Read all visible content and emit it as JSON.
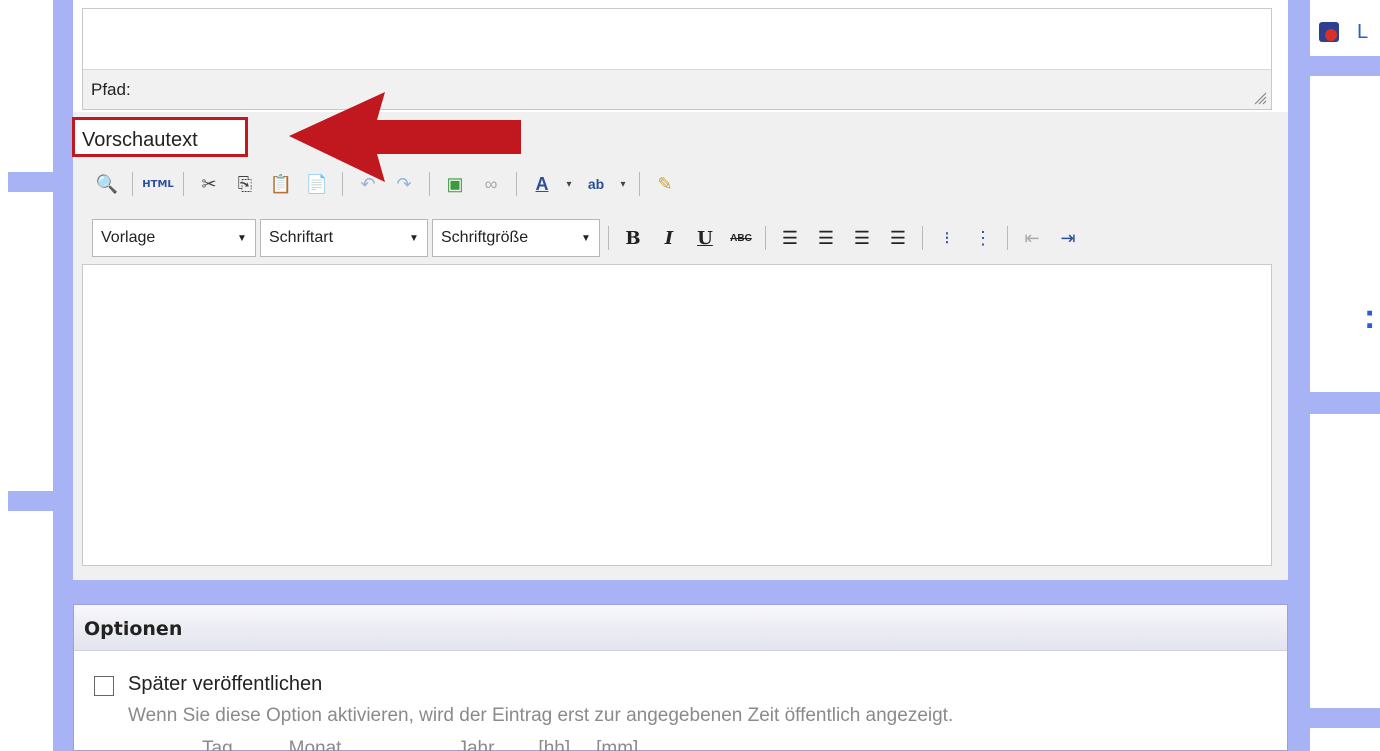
{
  "top_editor": {
    "path_label": "Pfad:"
  },
  "preview": {
    "label": "Vorschautext"
  },
  "toolbar": {
    "html_label": "HTML",
    "template_select": "Vorlage",
    "font_select": "Schriftart",
    "size_select": "Schriftgröße",
    "bold": "B",
    "italic": "I",
    "underline": "U",
    "strike": "ABC"
  },
  "options": {
    "title": "Optionen",
    "publish_later_label": "Später veröffentlichen",
    "publish_later_help": "Wenn Sie diese Option aktivieren, wird der Eintrag erst zur angegebenen Zeit öffentlich angezeigt.",
    "date_columns": [
      "Tag",
      "Monat",
      "Jahr",
      "[hh]",
      "[mm]"
    ]
  },
  "sidebar": {
    "link_text": "L"
  },
  "colors": {
    "frame": "#a7b3f5",
    "highlight": "#c0181e",
    "link": "#2b5bd6"
  }
}
